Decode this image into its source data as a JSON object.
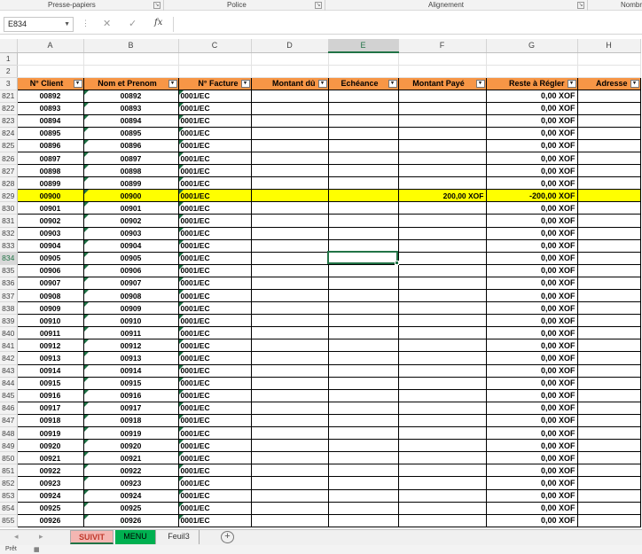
{
  "ribbon": {
    "groups": [
      "Presse-papiers",
      "Police",
      "Alignement",
      "Nombre"
    ]
  },
  "formula_bar": {
    "name_box": "E834",
    "fx": "fx",
    "formula": ""
  },
  "columns": [
    "A",
    "B",
    "C",
    "D",
    "E",
    "F",
    "G",
    "H"
  ],
  "selected_column": "E",
  "header_row": {
    "row": "3",
    "labels": [
      "N° Client",
      "Nom et Prenom",
      "N° Facture",
      "Montant dû",
      "Echéance",
      "Montant Payé",
      "Reste à Régler",
      "Adresse"
    ]
  },
  "blank_rows": [
    "1",
    "2"
  ],
  "data_rows": [
    {
      "row": "821",
      "client": "00892",
      "name": "00892",
      "invoice": "0001/EC",
      "paid": "",
      "remaining": "0,00 XOF"
    },
    {
      "row": "822",
      "client": "00893",
      "name": "00893",
      "invoice": "0001/EC",
      "paid": "",
      "remaining": "0,00 XOF"
    },
    {
      "row": "823",
      "client": "00894",
      "name": "00894",
      "invoice": "0001/EC",
      "paid": "",
      "remaining": "0,00 XOF"
    },
    {
      "row": "824",
      "client": "00895",
      "name": "00895",
      "invoice": "0001/EC",
      "paid": "",
      "remaining": "0,00 XOF"
    },
    {
      "row": "825",
      "client": "00896",
      "name": "00896",
      "invoice": "0001/EC",
      "paid": "",
      "remaining": "0,00 XOF"
    },
    {
      "row": "826",
      "client": "00897",
      "name": "00897",
      "invoice": "0001/EC",
      "paid": "",
      "remaining": "0,00 XOF"
    },
    {
      "row": "827",
      "client": "00898",
      "name": "00898",
      "invoice": "0001/EC",
      "paid": "",
      "remaining": "0,00 XOF"
    },
    {
      "row": "828",
      "client": "00899",
      "name": "00899",
      "invoice": "0001/EC",
      "paid": "",
      "remaining": "0,00 XOF"
    },
    {
      "row": "829",
      "client": "00900",
      "name": "00900",
      "invoice": "0001/EC",
      "paid": "200,00 XOF",
      "remaining": "-200,00 XOF",
      "highlight": true
    },
    {
      "row": "830",
      "client": "00901",
      "name": "00901",
      "invoice": "0001/EC",
      "paid": "",
      "remaining": "0,00 XOF"
    },
    {
      "row": "831",
      "client": "00902",
      "name": "00902",
      "invoice": "0001/EC",
      "paid": "",
      "remaining": "0,00 XOF"
    },
    {
      "row": "832",
      "client": "00903",
      "name": "00903",
      "invoice": "0001/EC",
      "paid": "",
      "remaining": "0,00 XOF"
    },
    {
      "row": "833",
      "client": "00904",
      "name": "00904",
      "invoice": "0001/EC",
      "paid": "",
      "remaining": "0,00 XOF"
    },
    {
      "row": "834",
      "client": "00905",
      "name": "00905",
      "invoice": "0001/EC",
      "paid": "",
      "remaining": "0,00 XOF",
      "active": true
    },
    {
      "row": "835",
      "client": "00906",
      "name": "00906",
      "invoice": "0001/EC",
      "paid": "",
      "remaining": "0,00 XOF"
    },
    {
      "row": "836",
      "client": "00907",
      "name": "00907",
      "invoice": "0001/EC",
      "paid": "",
      "remaining": "0,00 XOF"
    },
    {
      "row": "837",
      "client": "00908",
      "name": "00908",
      "invoice": "0001/EC",
      "paid": "",
      "remaining": "0,00 XOF"
    },
    {
      "row": "838",
      "client": "00909",
      "name": "00909",
      "invoice": "0001/EC",
      "paid": "",
      "remaining": "0,00 XOF"
    },
    {
      "row": "839",
      "client": "00910",
      "name": "00910",
      "invoice": "0001/EC",
      "paid": "",
      "remaining": "0,00 XOF"
    },
    {
      "row": "840",
      "client": "00911",
      "name": "00911",
      "invoice": "0001/EC",
      "paid": "",
      "remaining": "0,00 XOF"
    },
    {
      "row": "841",
      "client": "00912",
      "name": "00912",
      "invoice": "0001/EC",
      "paid": "",
      "remaining": "0,00 XOF"
    },
    {
      "row": "842",
      "client": "00913",
      "name": "00913",
      "invoice": "0001/EC",
      "paid": "",
      "remaining": "0,00 XOF"
    },
    {
      "row": "843",
      "client": "00914",
      "name": "00914",
      "invoice": "0001/EC",
      "paid": "",
      "remaining": "0,00 XOF"
    },
    {
      "row": "844",
      "client": "00915",
      "name": "00915",
      "invoice": "0001/EC",
      "paid": "",
      "remaining": "0,00 XOF"
    },
    {
      "row": "845",
      "client": "00916",
      "name": "00916",
      "invoice": "0001/EC",
      "paid": "",
      "remaining": "0,00 XOF"
    },
    {
      "row": "846",
      "client": "00917",
      "name": "00917",
      "invoice": "0001/EC",
      "paid": "",
      "remaining": "0,00 XOF"
    },
    {
      "row": "847",
      "client": "00918",
      "name": "00918",
      "invoice": "0001/EC",
      "paid": "",
      "remaining": "0,00 XOF"
    },
    {
      "row": "848",
      "client": "00919",
      "name": "00919",
      "invoice": "0001/EC",
      "paid": "",
      "remaining": "0,00 XOF"
    },
    {
      "row": "849",
      "client": "00920",
      "name": "00920",
      "invoice": "0001/EC",
      "paid": "",
      "remaining": "0,00 XOF"
    },
    {
      "row": "850",
      "client": "00921",
      "name": "00921",
      "invoice": "0001/EC",
      "paid": "",
      "remaining": "0,00 XOF"
    },
    {
      "row": "851",
      "client": "00922",
      "name": "00922",
      "invoice": "0001/EC",
      "paid": "",
      "remaining": "0,00 XOF"
    },
    {
      "row": "852",
      "client": "00923",
      "name": "00923",
      "invoice": "0001/EC",
      "paid": "",
      "remaining": "0,00 XOF"
    },
    {
      "row": "853",
      "client": "00924",
      "name": "00924",
      "invoice": "0001/EC",
      "paid": "",
      "remaining": "0,00 XOF"
    },
    {
      "row": "854",
      "client": "00925",
      "name": "00925",
      "invoice": "0001/EC",
      "paid": "",
      "remaining": "0,00 XOF"
    },
    {
      "row": "855",
      "client": "00926",
      "name": "00926",
      "invoice": "0001/EC",
      "paid": "",
      "remaining": "0,00 XOF"
    }
  ],
  "sheet_tabs": [
    "SUIVIT",
    "MENU",
    "Feuil3"
  ],
  "active_tab": "SUIVIT",
  "status": {
    "ready": "Prêt"
  },
  "colors": {
    "header_fill": "#f79646",
    "highlight_fill": "#ffff00",
    "selection": "#217346",
    "menu_tab": "#00b050",
    "suivit_tab": "#f4b6b2"
  }
}
